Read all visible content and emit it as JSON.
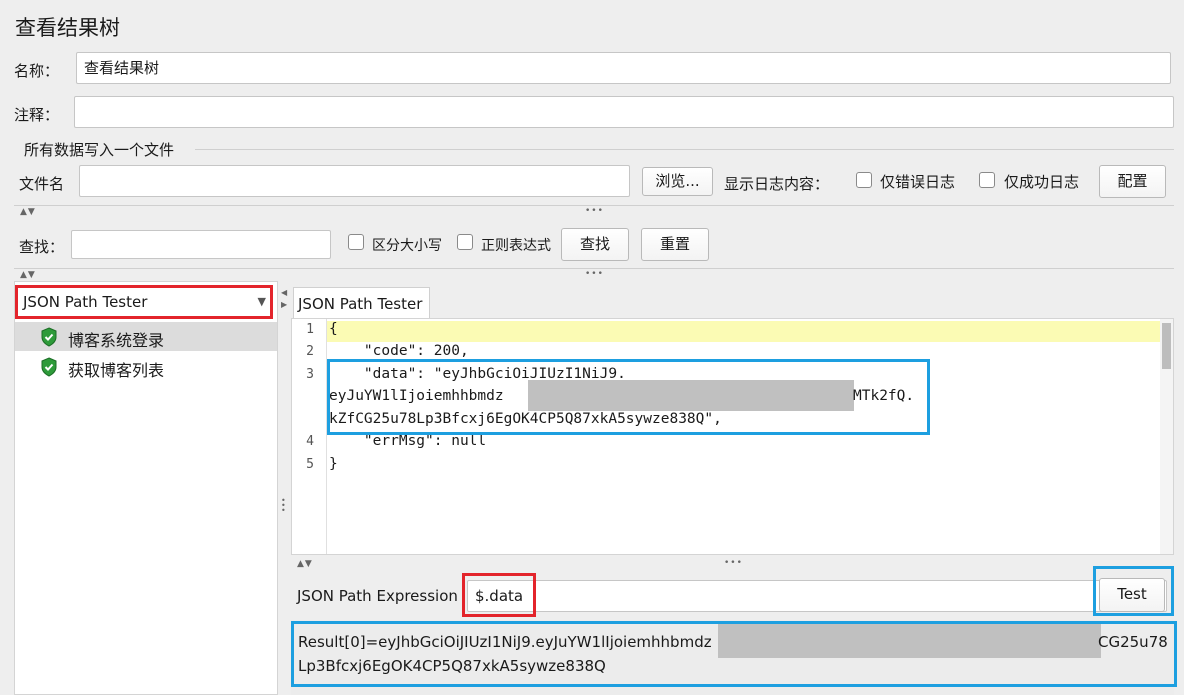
{
  "title": "查看结果树",
  "name_label": "名称：",
  "name_value": "查看结果树",
  "comment_label": "注释：",
  "comment_value": "",
  "file_section_title": "所有数据写入一个文件",
  "filename_label": "文件名",
  "filename_value": "",
  "browse_button": "浏览...",
  "log_content_label": "显示日志内容：",
  "errors_only_label": "仅错误日志",
  "success_only_label": "仅成功日志",
  "config_button": "配置",
  "search_label": "查找：",
  "search_value": "",
  "case_sensitive_label": "区分大小写",
  "regex_label": "正则表达式",
  "find_button": "查找",
  "reset_button": "重置",
  "renderer_select": "JSON Path Tester",
  "tree_items": [
    "博客系统登录",
    "获取博客列表"
  ],
  "tab_label": "JSON Path Tester",
  "code_lines": {
    "l1": "{",
    "l2": "    \"code\": 200,",
    "l3a": "    \"data\": \"eyJhbGciOiJIUzI1NiJ9.",
    "l3b": "eyJuYW1lIjoiemhhbmdz",
    "l3b_tail": "MTk2fQ.",
    "l3c": "kZfCG25u78Lp3Bfcxj6EgOK4CP5Q87xkA5sywze838Q\",",
    "l4": "    \"errMsg\": null",
    "l5": "}"
  },
  "line_numbers": [
    "1",
    "2",
    "3",
    "4",
    "5"
  ],
  "expr_label": "JSON Path Expression",
  "expr_value": "$.data",
  "test_button": "Test",
  "result_line1_start": "Result[0]=eyJhbGciOiJIUzI1NiJ9.eyJuYW1lIjoiemhhbmdz",
  "result_line1_end": "CG25u78",
  "result_line2": "Lp3Bfcxj6EgOK4CP5Q87xkA5sywze838Q"
}
